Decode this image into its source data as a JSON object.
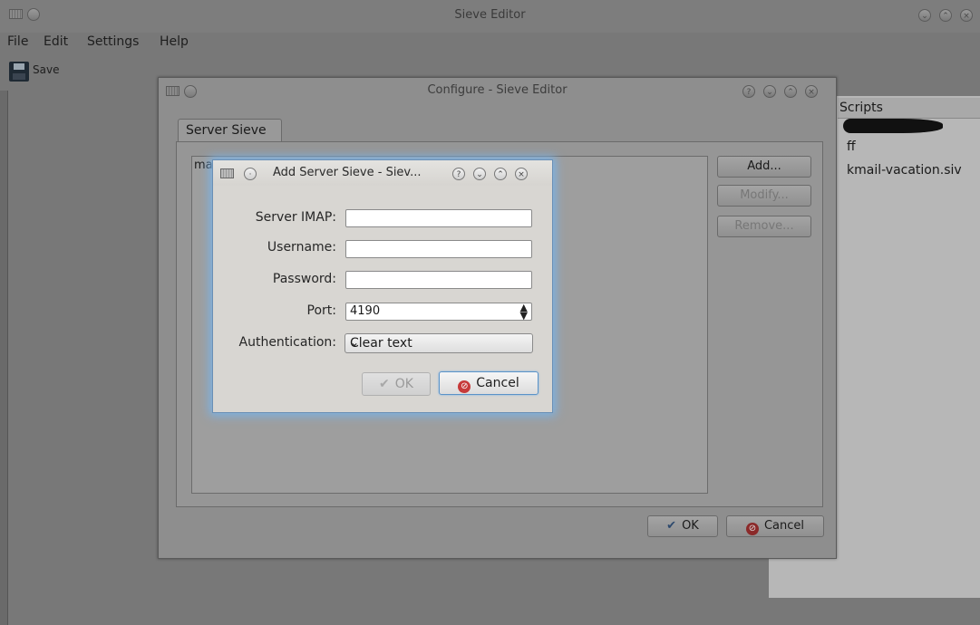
{
  "main_window": {
    "title": "Sieve Editor",
    "menu": [
      "File",
      "Edit",
      "Settings",
      "Help"
    ],
    "toolbar": {
      "save_label": "Save"
    },
    "scripts_panel": {
      "header": "Scripts",
      "items": [
        "ff",
        "kmail-vacation.siv"
      ]
    }
  },
  "configure_dialog": {
    "title": "Configure - Sieve Editor",
    "tab_label": "Server Sieve",
    "list_first_item": "ma",
    "buttons": {
      "add": "Add...",
      "modify": "Modify...",
      "remove": "Remove..."
    },
    "ok_label": "OK",
    "cancel_label": "Cancel"
  },
  "add_server_dialog": {
    "title": "Add Server Sieve - Siev...",
    "fields": {
      "server_imap_label": "Server IMAP:",
      "server_imap_value": "",
      "username_label": "Username:",
      "username_value": "",
      "password_label": "Password:",
      "password_value": "",
      "port_label": "Port:",
      "port_value": "4190",
      "authentication_label": "Authentication:",
      "authentication_value": "Clear text"
    },
    "ok_label": "OK",
    "cancel_label": "Cancel"
  },
  "colors": {
    "dimmed_background": "#787878",
    "dialog_glow": "#7ab2e6",
    "cancel_icon": "#c73a3a"
  }
}
